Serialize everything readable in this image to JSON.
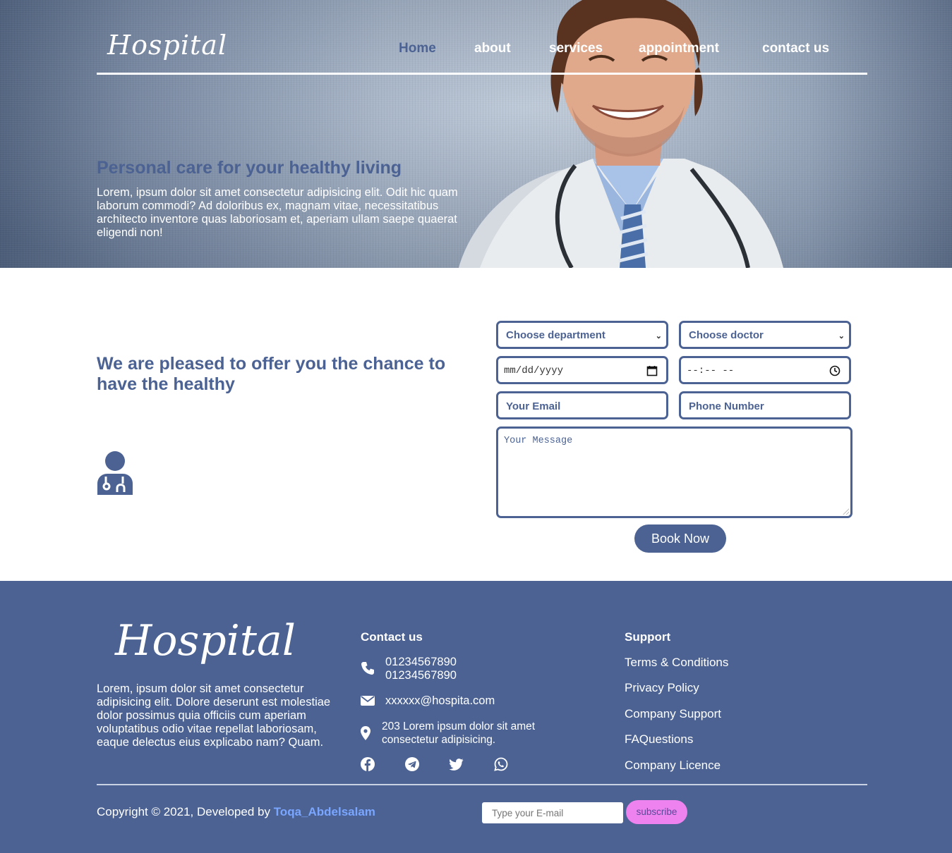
{
  "header": {
    "logo": "Hospital",
    "nav": [
      {
        "label": "Home",
        "active": true
      },
      {
        "label": "about",
        "active": false
      },
      {
        "label": "services",
        "active": false
      },
      {
        "label": "appointment",
        "active": false
      },
      {
        "label": "contact us",
        "active": false
      }
    ]
  },
  "hero": {
    "title": "Personal care for your healthy living",
    "text": "Lorem, ipsum dolor sit amet consectetur adipisicing elit. Odit hic quam laborum commodi? Ad doloribus ex, magnam vitae, necessitatibus architecto inventore quas laboriosam et, aperiam ullam saepe quaerat eligendi non!"
  },
  "booking": {
    "title": "We are pleased to offer you the chance to have the healthy",
    "department": "Choose department",
    "doctor": "Choose doctor",
    "date_placeholder": "mm/dd/yyyy",
    "time_placeholder": "--:-- --",
    "email_placeholder": "Your Email",
    "phone_placeholder": "Phone Number",
    "message_placeholder": "Your Message",
    "book_label": "Book Now"
  },
  "footer": {
    "logo": "Hospital",
    "about": "Lorem, ipsum dolor sit amet consectetur adipisicing elit. Dolore deserunt est molestiae dolor possimus quia officiis cum aperiam voluptatibus odio vitae repellat laboriosam, eaque delectus eius explicabo nam? Quam.",
    "contact_heading": "Contact us",
    "phone1": "01234567890",
    "phone2": "01234567890",
    "email": "xxxxxx@hospita.com",
    "address": "203 Lorem ipsum dolor sit amet consectetur adipisicing.",
    "social": [
      "facebook-icon",
      "telegram-icon",
      "twitter-icon",
      "whatsapp-icon"
    ],
    "support_heading": "Support",
    "support_links": [
      "Terms & Conditions",
      "Privacy Policy",
      "Company Support",
      "FAQuestions",
      "Company Licence"
    ],
    "copyright_prefix": "Copyright © 2021, Developed by",
    "author": "Toqa_Abdelsalam",
    "subscribe_placeholder": "Type your E-mail",
    "subscribe_label": "subscribe"
  },
  "colors": {
    "brand": "#4b6293",
    "accent_link": "#7aa6ff",
    "subscribe_bg": "#ee82ee"
  }
}
